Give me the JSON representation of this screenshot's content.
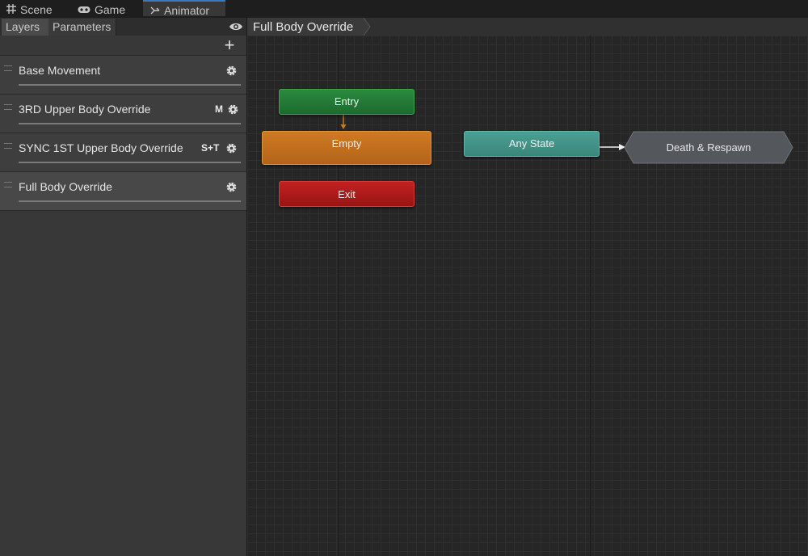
{
  "window_tabs": [
    {
      "label": "Scene",
      "icon": "grid-icon"
    },
    {
      "label": "Game",
      "icon": "gamepad-icon"
    },
    {
      "label": "Animator",
      "icon": "animator-icon"
    }
  ],
  "left_panel": {
    "tabs": [
      "Layers",
      "Parameters"
    ],
    "add_label": "+",
    "layers": [
      {
        "name": "Base Movement",
        "flag": ""
      },
      {
        "name": "3RD Upper Body Override",
        "flag": "M"
      },
      {
        "name": "SYNC 1ST Upper Body Override",
        "flag": "S+T"
      },
      {
        "name": "Full Body Override",
        "flag": ""
      }
    ]
  },
  "graph": {
    "breadcrumb": "Full Body Override",
    "states": {
      "entry": "Entry",
      "empty": "Empty",
      "exit": "Exit",
      "any_state": "Any State",
      "state_machine": "Death & Respawn"
    }
  },
  "colors": {
    "accent": "#3a79bb",
    "entry": "#2a8a3e",
    "default_state": "#cf7a22",
    "exit": "#c22121",
    "any_state": "#4a9f94",
    "state_machine": "#5a5e63"
  }
}
